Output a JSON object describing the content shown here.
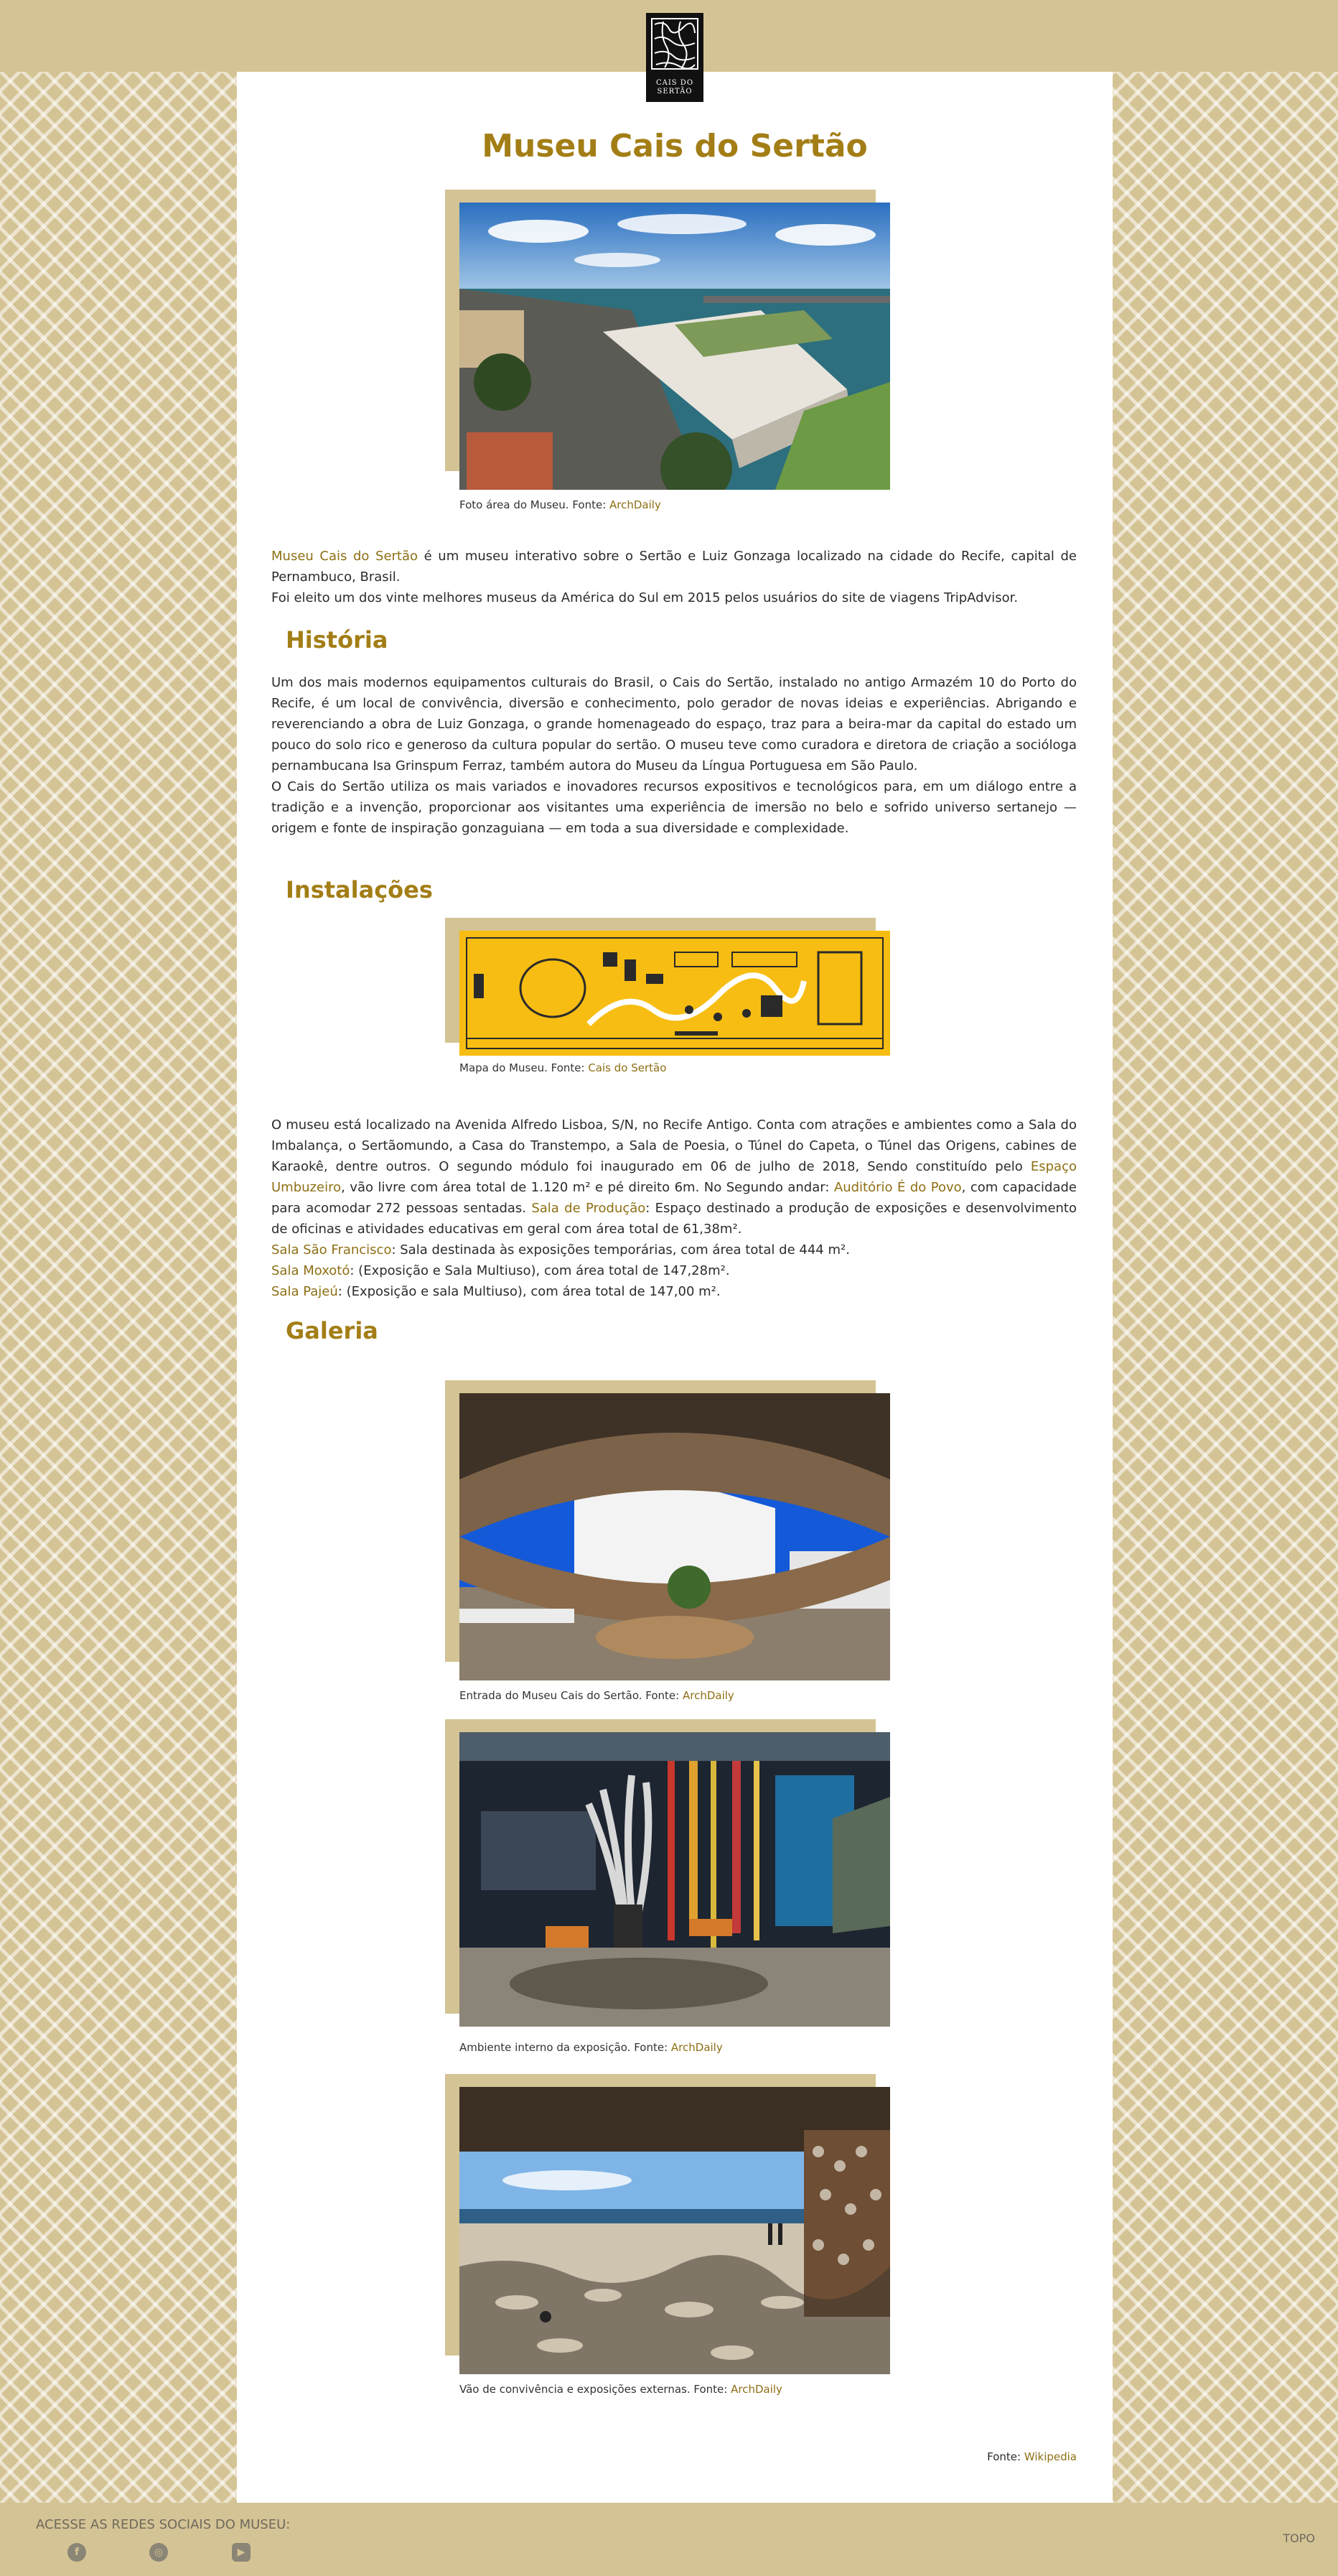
{
  "header": {
    "logo_text_1": "CAIS DO",
    "logo_text_2": "SERTÃO"
  },
  "page": {
    "title": "Museu Cais do Sertão"
  },
  "hero": {
    "caption_text": "Foto área do Museu. Fonte: ",
    "caption_link": "ArchDaily"
  },
  "intro": {
    "link": "Museu Cais do Sertão",
    "text_1": " é um museu interativo sobre o Sertão e Luiz Gonzaga localizado na cidade do Recife, capital de Pernambuco, Brasil.",
    "text_2": "Foi eleito um dos vinte melhores museus da América do Sul em 2015 pelos usuários do site de viagens TripAdvisor."
  },
  "historia": {
    "heading": "História",
    "p1": "Um dos mais modernos equipamentos culturais do Brasil, o Cais do Sertão, instalado no antigo Armazém 10 do Porto do Recife, é um local de convivência, diversão e conhecimento, polo gerador de novas ideias e experiências. Abrigando e reverenciando a obra de Luiz Gonzaga, o grande homenageado do espaço, traz para a beira-mar da capital do estado um pouco do solo rico e generoso da cultura popular do sertão. O museu teve como curadora e diretora de criação a socióloga pernambucana Isa Grinspum Ferraz, também autora do Museu da Língua Portuguesa em São Paulo.",
    "p2": "O Cais do Sertão utiliza os mais variados e inovadores recursos expositivos e tecnológicos para, em um diálogo entre a tradição e a invenção, proporcionar aos visitantes uma experiência de imersão no belo e sofrido universo sertanejo — origem e fonte de inspiração gonzaguiana — em toda a sua diversidade e complexidade."
  },
  "instalacoes": {
    "heading": "Instalações",
    "map_caption_text": "Mapa do Museu. Fonte: ",
    "map_caption_link": "Cais do Sertão",
    "t1": "O museu está localizado na Avenida Alfredo Lisboa, S/N, no Recife Antigo. Conta com atrações e ambientes como a Sala do Imbalança, o Sertãomundo, a Casa do Transtempo, a Sala de Poesia, o Túnel do Capeta, o Túnel das Origens, cabines de Karaokê, dentre outros. O segundo módulo foi inaugurado em 06 de julho de 2018, Sendo constituído pelo ",
    "l1": "Espaço Umbuzeiro",
    "t2": ", vão livre com área total de 1.120 m² e pé direito 6m. No Segundo andar: ",
    "l2": "Auditório É do Povo",
    "t3": ", com capacidade para acomodar 272 pessoas sentadas. ",
    "l3": "Sala de Produção",
    "t4": ": Espaço destinado a produção de exposições e desenvolvimento de oficinas e atividades educativas em geral com área total de 61,38m².",
    "l4": "Sala São Francisco",
    "t5": ": Sala destinada às exposições temporárias, com área total de 444 m².",
    "l5": "Sala Moxotó",
    "t6": ": (Exposição e Sala Multiuso), com área total de 147,28m².",
    "l6": "Sala Pajeú",
    "t7": ": (Exposição e sala Multiuso), com área total de 147,00 m²."
  },
  "galeria": {
    "heading": "Galeria",
    "items": [
      {
        "caption_text": "Entrada do Museu Cais do Sertão. Fonte: ",
        "caption_link": "ArchDaily"
      },
      {
        "caption_text": "Ambiente interno da exposição. Fonte: ",
        "caption_link": "ArchDaily"
      },
      {
        "caption_text": "Vão de convivência e exposições externas. Fonte: ",
        "caption_link": "ArchDaily"
      }
    ]
  },
  "source": {
    "text": "Fonte: ",
    "link": "Wikipedia"
  },
  "footer": {
    "social_label": "ACESSE AS REDES SOCIAIS DO MUSEU:",
    "icons": [
      "facebook-icon",
      "instagram-icon",
      "youtube-icon"
    ],
    "top_link": "TOPO"
  },
  "colors": {
    "accent": "#a37e16",
    "beige": "#d4c394",
    "map_yellow": "#f7bd12"
  }
}
